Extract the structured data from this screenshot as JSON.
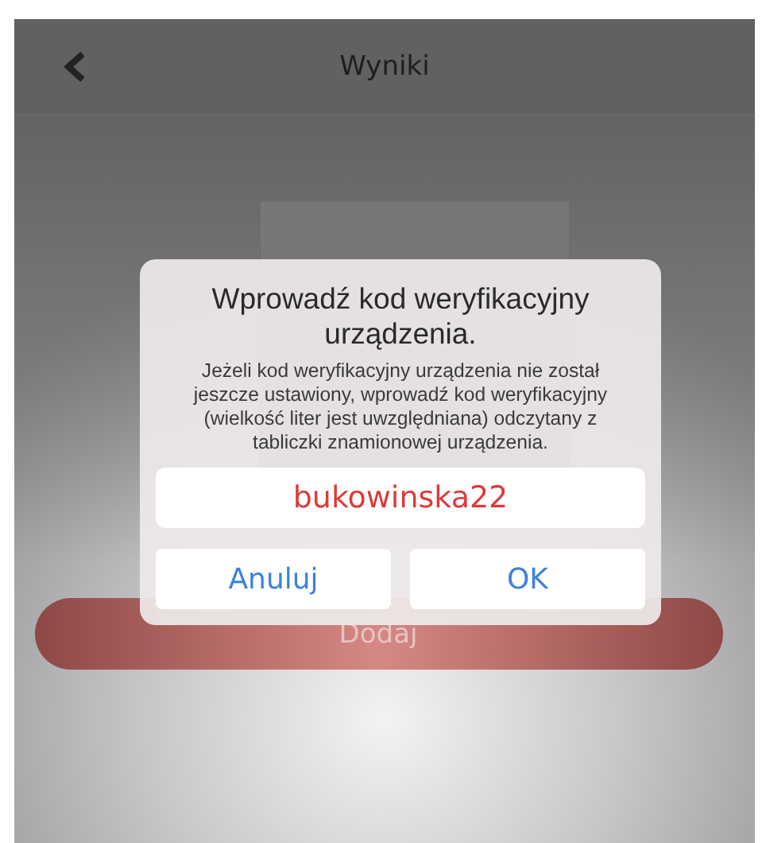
{
  "header": {
    "title": "Wyniki"
  },
  "add_button": {
    "label": "Dodaj"
  },
  "dialog": {
    "title": "Wprowadź kod weryfikacyjny urządzenia.",
    "message": "Jeżeli kod weryfikacyjny urządzenia nie został jeszcze ustawiony, wprowadź kod weryfikacyjny (wielkość liter jest uwzględniana) odczytany z tabliczki znamionowej urządzenia.",
    "value": "bukowinska22",
    "buttons": [
      "Anuluj",
      "OK"
    ]
  }
}
